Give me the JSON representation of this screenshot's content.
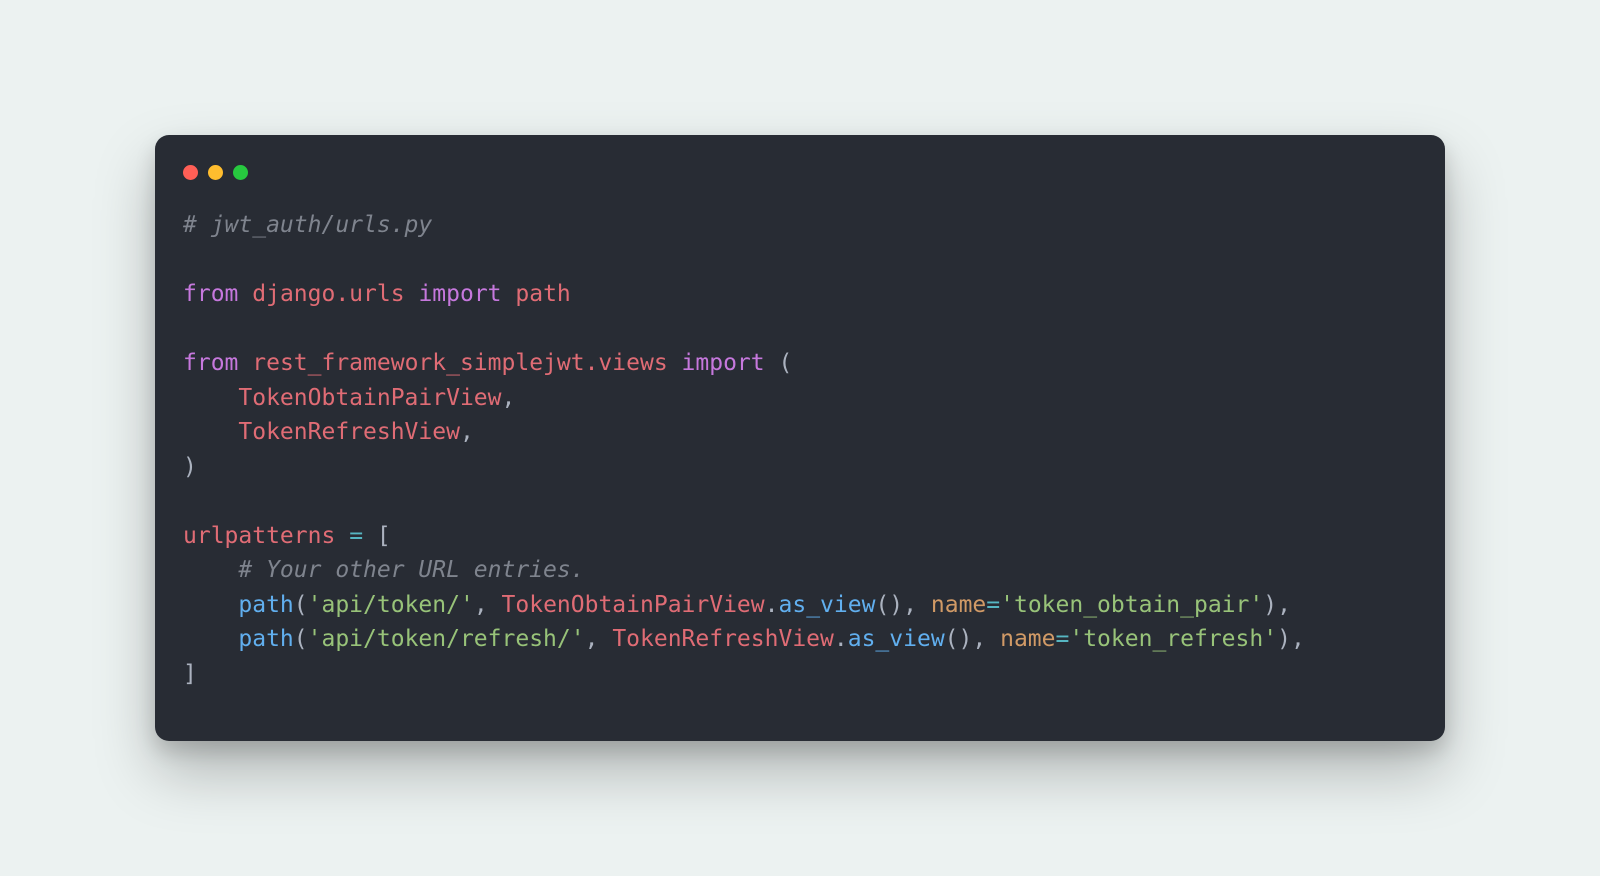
{
  "code": {
    "line1_comment": "# jwt_auth/urls.py",
    "kw_from": "from",
    "kw_import": "import",
    "mod_django_urls": "django.urls",
    "fn_path": "path",
    "mod_simplejwt": "rest_framework_simplejwt.views",
    "cls_obtain": "TokenObtainPairView",
    "cls_refresh": "TokenRefreshView",
    "var_urlpatterns": "urlpatterns",
    "op_assign": "=",
    "comment_other": "# Your other URL entries.",
    "str_api_token": "'api/token/'",
    "str_api_token_refresh": "'api/token/refresh/'",
    "method_as_view": "as_view",
    "param_name": "name",
    "str_name_obtain": "'token_obtain_pair'",
    "str_name_refresh": "'token_refresh'",
    "p_open": "(",
    "p_close": ")",
    "b_open": "[",
    "b_close": "]",
    "comma": ",",
    "dot": "."
  }
}
